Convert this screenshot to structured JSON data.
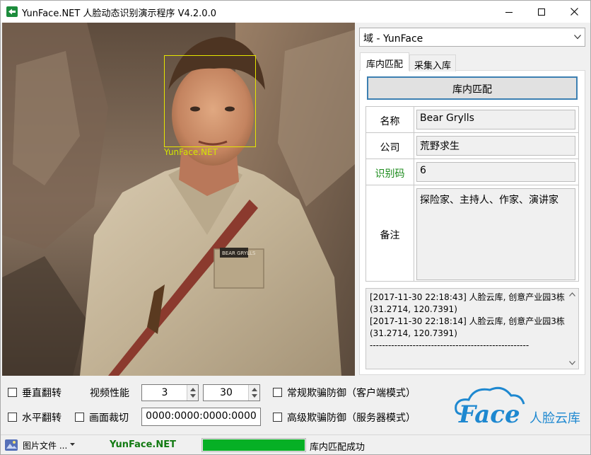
{
  "window": {
    "title": "YunFace.NET 人脸动态识别演示程序 V4.2.0.0",
    "controls": [
      "minimize-icon",
      "maximize-icon",
      "close-icon"
    ]
  },
  "video": {
    "face_label": "YunFace.NET",
    "shirt_badge_text": "BEAR GRYLLS"
  },
  "domain_select": {
    "value": "域 - YunFace"
  },
  "tabs": [
    {
      "label": "库内匹配",
      "active": true
    },
    {
      "label": "采集入库",
      "active": false
    }
  ],
  "match_button": {
    "label": "库内匹配"
  },
  "info": {
    "name_label": "名称",
    "name_value": "Bear Grylls",
    "company_label": "公司",
    "company_value": "荒野求生",
    "id_label": "识别码",
    "id_value": "6",
    "note_label": "备注",
    "note_value": "探险家、主持人、作家、演讲家",
    "id_label_color": "#1a8a1a"
  },
  "log": {
    "lines": [
      "[2017-11-30 22:18:43] 人脸云库, 创意产业园3栋",
      "(31.2714, 120.7391)",
      "[2017-11-30 22:18:14] 人脸云库, 创意产业园3栋",
      "(31.2714, 120.7391)",
      "----------------------------------------------------"
    ]
  },
  "controls": {
    "vertical_flip": {
      "label": "垂直翻转",
      "checked": false
    },
    "horizontal_flip": {
      "label": "水平翻转",
      "checked": false
    },
    "video_perf_label": "视频性能",
    "perf_value_1": "3",
    "perf_value_2": "30",
    "crop": {
      "label": "画面裁切",
      "checked": false
    },
    "crop_value": "0000:0000:0000:0000",
    "normal_anti_spoof": {
      "label": "常规欺骗防御（客户端模式）",
      "checked": false
    },
    "advanced_anti_spoof": {
      "label": "高级欺骗防御（服务器模式）",
      "checked": false
    }
  },
  "logo": {
    "text_main": "Face",
    "text_sub": "人脸云库",
    "color": "#1e88d0"
  },
  "statusbar": {
    "source_label": "图片文件 ...",
    "brand": "YunFace.NET",
    "progress": 1.0,
    "status_text": "库内匹配成功",
    "progress_color": "#06b025"
  }
}
